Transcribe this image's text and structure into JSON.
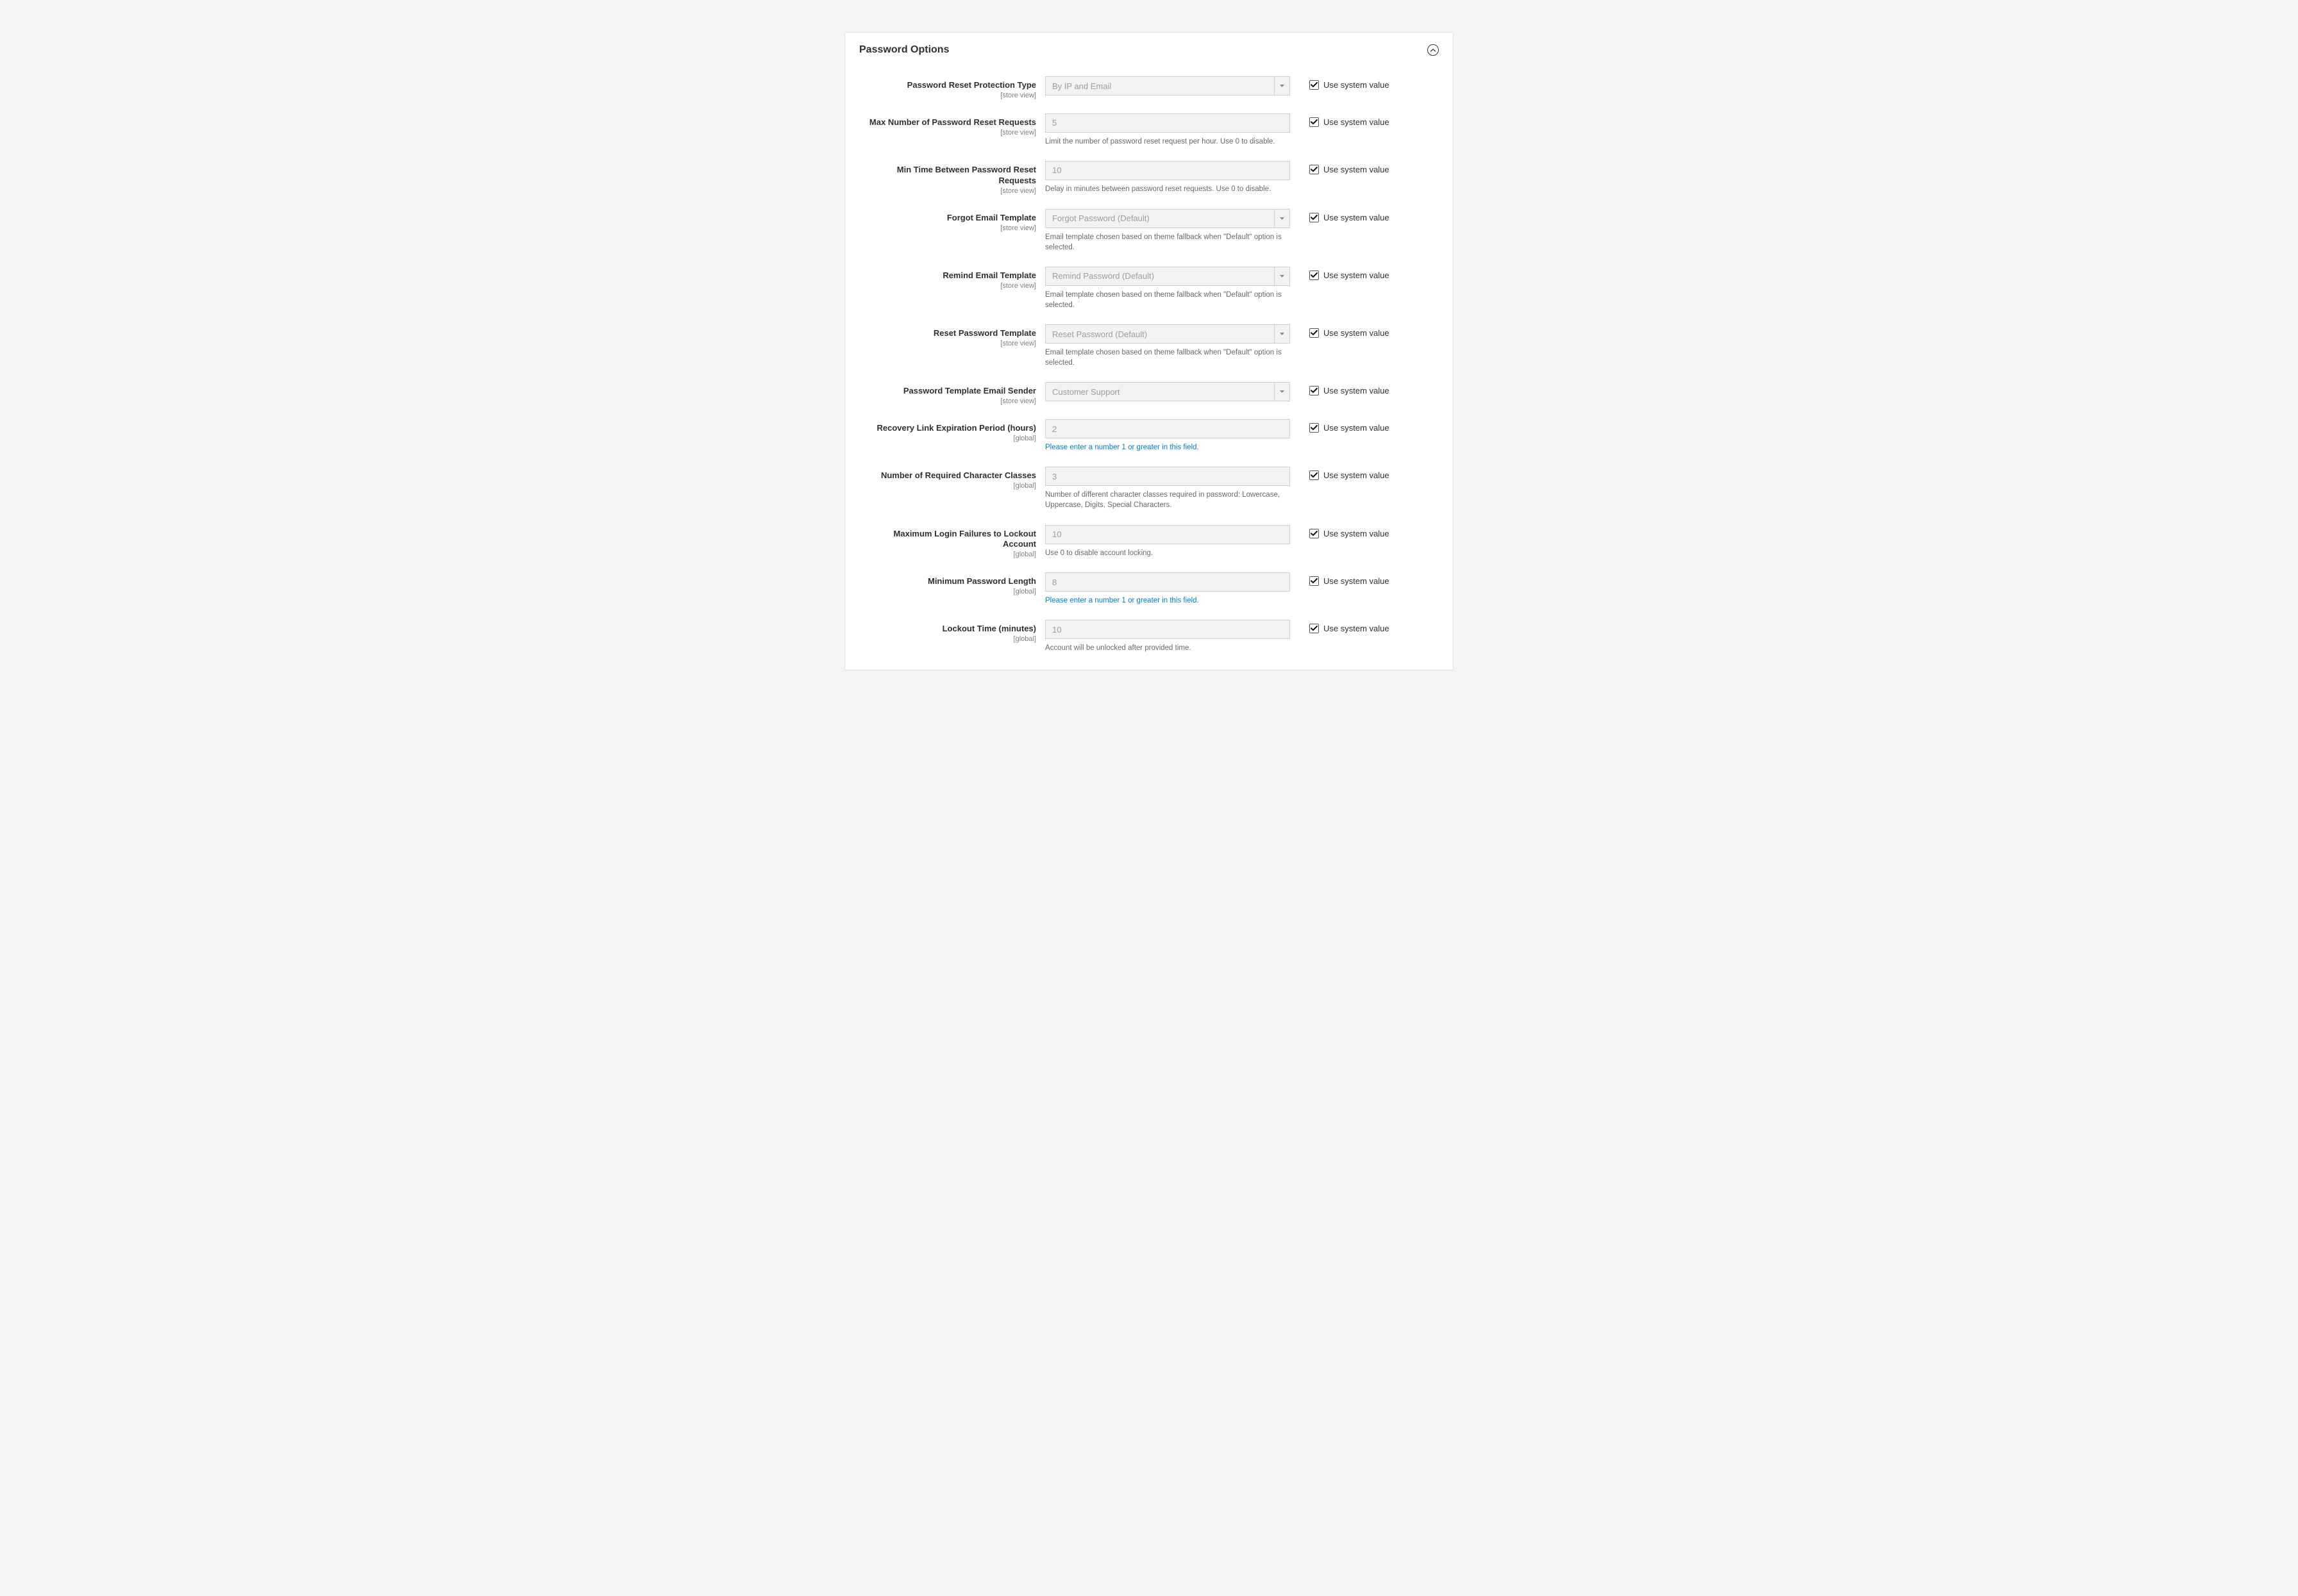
{
  "section": {
    "title": "Password Options",
    "use_system_value_label": "Use system value"
  },
  "fields": [
    {
      "key": "protection_type",
      "label": "Password Reset Protection Type",
      "scope": "[store view]",
      "type": "select",
      "value": "By IP and Email",
      "hint": "",
      "use_system": true
    },
    {
      "key": "max_requests",
      "label": "Max Number of Password Reset Requests",
      "scope": "[store view]",
      "type": "text",
      "value": "5",
      "hint": "Limit the number of password reset request per hour. Use 0 to disable.",
      "use_system": true
    },
    {
      "key": "min_time",
      "label": "Min Time Between Password Reset Requests",
      "scope": "[store view]",
      "type": "text",
      "value": "10",
      "hint": "Delay in minutes between password reset requests. Use 0 to disable.",
      "use_system": true
    },
    {
      "key": "forgot_template",
      "label": "Forgot Email Template",
      "scope": "[store view]",
      "type": "select",
      "value": "Forgot Password (Default)",
      "hint": "Email template chosen based on theme fallback when \"Default\" option is selected.",
      "use_system": true
    },
    {
      "key": "remind_template",
      "label": "Remind Email Template",
      "scope": "[store view]",
      "type": "select",
      "value": "Remind Password (Default)",
      "hint": "Email template chosen based on theme fallback when \"Default\" option is selected.",
      "use_system": true
    },
    {
      "key": "reset_template",
      "label": "Reset Password Template",
      "scope": "[store view]",
      "type": "select",
      "value": "Reset Password (Default)",
      "hint": "Email template chosen based on theme fallback when \"Default\" option is selected.",
      "use_system": true
    },
    {
      "key": "email_sender",
      "label": "Password Template Email Sender",
      "scope": "[store view]",
      "type": "select",
      "value": "Customer Support",
      "hint": "",
      "use_system": true
    },
    {
      "key": "recovery_expiration",
      "label": "Recovery Link Expiration Period (hours)",
      "scope": "[global]",
      "type": "text",
      "value": "2",
      "hint_link": "Please enter a number 1 or greater in this field.",
      "use_system": true
    },
    {
      "key": "char_classes",
      "label": "Number of Required Character Classes",
      "scope": "[global]",
      "type": "text",
      "value": "3",
      "hint": "Number of different character classes required in password: Lowercase, Uppercase, Digits, Special Characters.",
      "use_system": true
    },
    {
      "key": "lockout_failures",
      "label": "Maximum Login Failures to Lockout Account",
      "scope": "[global]",
      "type": "text",
      "value": "10",
      "hint": "Use 0 to disable account locking.",
      "use_system": true
    },
    {
      "key": "min_length",
      "label": "Minimum Password Length",
      "scope": "[global]",
      "type": "text",
      "value": "8",
      "hint_link": "Please enter a number 1 or greater in this field.",
      "use_system": true
    },
    {
      "key": "lockout_time",
      "label": "Lockout Time (minutes)",
      "scope": "[global]",
      "type": "text",
      "value": "10",
      "hint": "Account will be unlocked after provided time.",
      "use_system": true
    }
  ]
}
